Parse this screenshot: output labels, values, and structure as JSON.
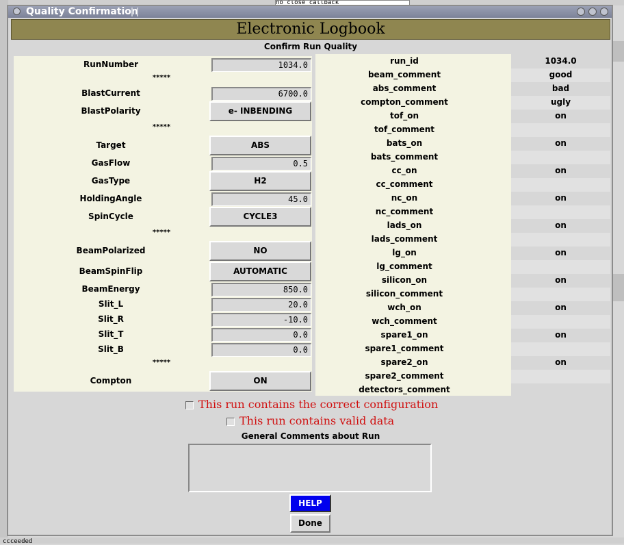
{
  "background": {
    "top_strip_text": "no close callback",
    "bottom_strip_text": "ccceeded"
  },
  "window": {
    "title": "Quality Confirmation",
    "banner": "Electronic Logbook",
    "subtitle": "Confirm Run Quality"
  },
  "left_form": {
    "run_number": {
      "label": "RunNumber",
      "value": "1034.0"
    },
    "stars1": "*****",
    "blast_current": {
      "label": "BlastCurrent",
      "value": "6700.0"
    },
    "blast_polarity": {
      "label": "BlastPolarity",
      "value": "e- INBENDING"
    },
    "stars2": "*****",
    "target": {
      "label": "Target",
      "value": "ABS"
    },
    "gas_flow": {
      "label": "GasFlow",
      "value": "0.5"
    },
    "gas_type": {
      "label": "GasType",
      "value": "H2"
    },
    "holding_angle": {
      "label": "HoldingAngle",
      "value": "45.0"
    },
    "spin_cycle": {
      "label": "SpinCycle",
      "value": "CYCLE3"
    },
    "stars3": "*****",
    "beam_polarized": {
      "label": "BeamPolarized",
      "value": "NO"
    },
    "beam_spin_flip": {
      "label": "BeamSpinFlip",
      "value": "AUTOMATIC"
    },
    "beam_energy": {
      "label": "BeamEnergy",
      "value": "850.0"
    },
    "slit_l": {
      "label": "Slit_L",
      "value": "20.0"
    },
    "slit_r": {
      "label": "Slit_R",
      "value": "-10.0"
    },
    "slit_t": {
      "label": "Slit_T",
      "value": "0.0"
    },
    "slit_b": {
      "label": "Slit_B",
      "value": "0.0"
    },
    "stars4": "*****",
    "compton": {
      "label": "Compton",
      "value": "ON"
    }
  },
  "right_table": [
    {
      "key": "run_id",
      "value": "1034.0"
    },
    {
      "key": "beam_comment",
      "value": "good"
    },
    {
      "key": "abs_comment",
      "value": "bad"
    },
    {
      "key": "compton_comment",
      "value": "ugly"
    },
    {
      "key": "tof_on",
      "value": "on"
    },
    {
      "key": "tof_comment",
      "value": ""
    },
    {
      "key": "bats_on",
      "value": "on"
    },
    {
      "key": "bats_comment",
      "value": ""
    },
    {
      "key": "cc_on",
      "value": "on"
    },
    {
      "key": "cc_comment",
      "value": ""
    },
    {
      "key": "nc_on",
      "value": "on"
    },
    {
      "key": "nc_comment",
      "value": ""
    },
    {
      "key": "lads_on",
      "value": "on"
    },
    {
      "key": "lads_comment",
      "value": ""
    },
    {
      "key": "lg_on",
      "value": "on"
    },
    {
      "key": "lg_comment",
      "value": ""
    },
    {
      "key": "silicon_on",
      "value": "on"
    },
    {
      "key": "silicon_comment",
      "value": ""
    },
    {
      "key": "wch_on",
      "value": "on"
    },
    {
      "key": "wch_comment",
      "value": ""
    },
    {
      "key": "spare1_on",
      "value": "on"
    },
    {
      "key": "spare1_comment",
      "value": ""
    },
    {
      "key": "spare2_on",
      "value": "on"
    },
    {
      "key": "spare2_comment",
      "value": ""
    },
    {
      "key": "detectors_comment",
      "value": ""
    }
  ],
  "checks": {
    "config_label": "This run contains the correct configuration",
    "valid_label": "This run contains valid data"
  },
  "comments": {
    "label": "General Comments about Run",
    "value": ""
  },
  "buttons": {
    "help": "HELP",
    "done": "Done"
  },
  "colors": {
    "banner": "#8f8650",
    "panel": "#f3f3e2",
    "help": "#0000ee",
    "check_text": "#d01010"
  }
}
